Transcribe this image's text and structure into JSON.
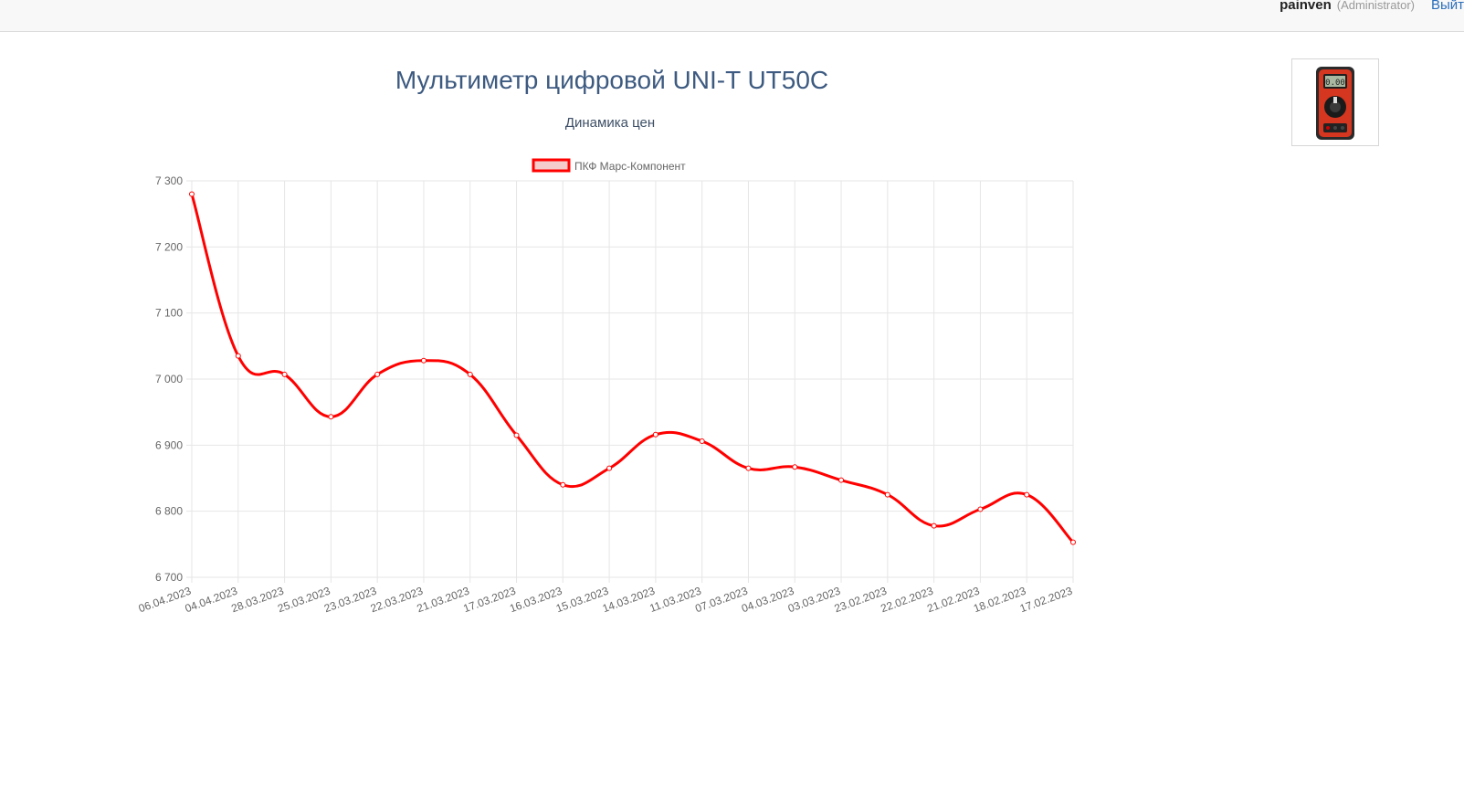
{
  "header": {
    "username": "painven",
    "role": "(Administrator)",
    "logout_label": "Выйти"
  },
  "product": {
    "title": "Мультиметр цифровой UNI-T UT50C",
    "thumb_icon": "multimeter-photo-icon"
  },
  "colors": {
    "series": "#ff0000",
    "title": "#3d5a80",
    "grid": "#e6e6e6"
  },
  "chart_data": {
    "type": "line",
    "title": "Динамика цен",
    "xlabel": "",
    "ylabel": "",
    "legend_position": "top",
    "grid": true,
    "ylim": [
      6700,
      7300
    ],
    "yticks": [
      "7 300",
      "7 200",
      "7 100",
      "7 000",
      "6 900",
      "6 800",
      "6 700"
    ],
    "categories": [
      "06.04.2023",
      "04.04.2023",
      "28.03.2023",
      "25.03.2023",
      "23.03.2023",
      "22.03.2023",
      "21.03.2023",
      "17.03.2023",
      "16.03.2023",
      "15.03.2023",
      "14.03.2023",
      "11.03.2023",
      "07.03.2023",
      "04.03.2023",
      "03.03.2023",
      "23.02.2023",
      "22.02.2023",
      "21.02.2023",
      "18.02.2023",
      "17.02.2023"
    ],
    "series": [
      {
        "name": "ПКФ Марс-Компонент",
        "values": [
          7280,
          7035,
          7007,
          6943,
          7007,
          7028,
          7007,
          6915,
          6840,
          6865,
          6916,
          6906,
          6865,
          6867,
          6847,
          6825,
          6778,
          6803,
          6825,
          6753
        ]
      }
    ]
  }
}
